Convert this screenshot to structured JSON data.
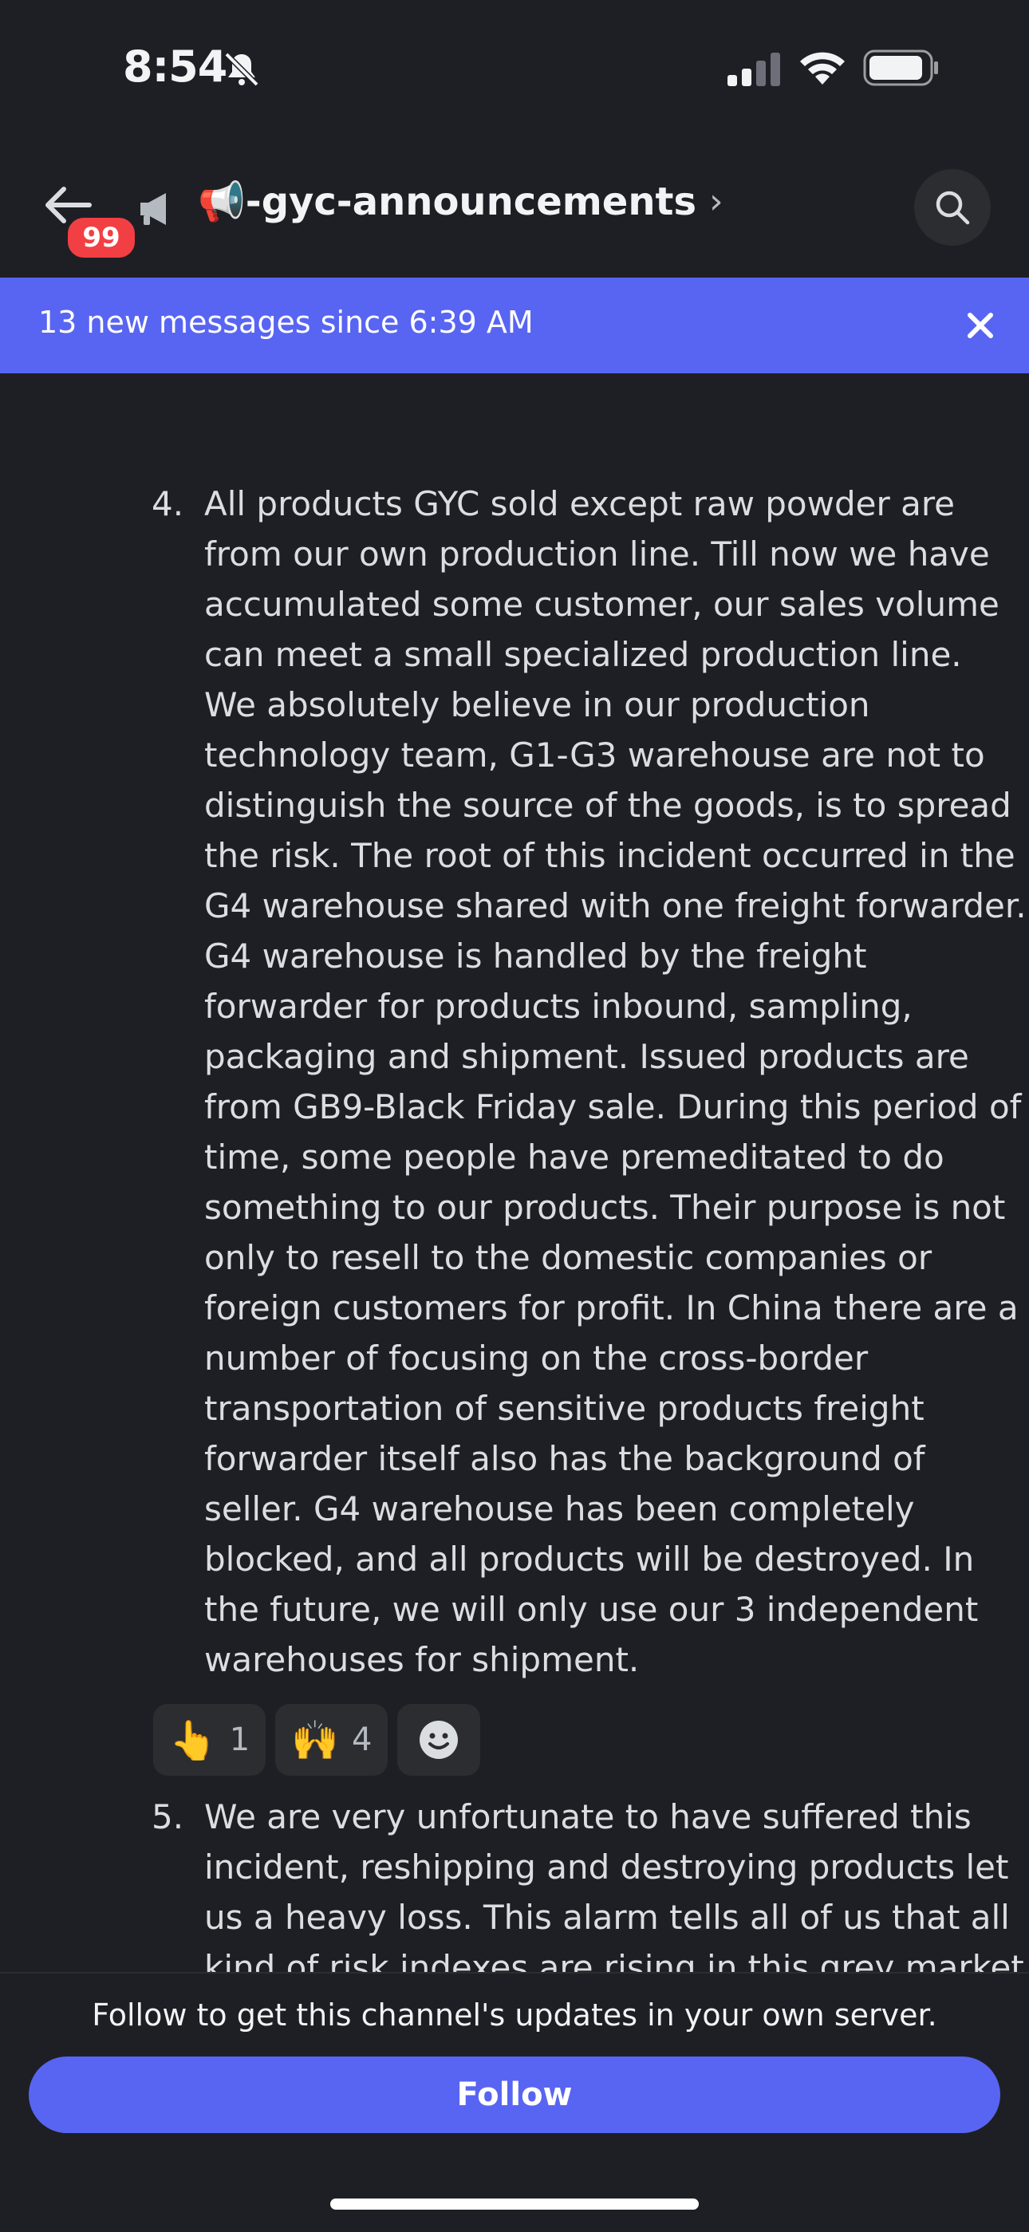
{
  "status_bar": {
    "time": "8:54"
  },
  "header": {
    "unread_badge": "99",
    "channel_emoji": "📢",
    "channel_name": "-gyc-announcements",
    "chevron": "›"
  },
  "new_messages_bar": {
    "text": "13 new messages since 6:39 AM",
    "close_icon": "×"
  },
  "message": {
    "item4": {
      "number": "4.",
      "lines": [
        "All products GYC sold except raw powder are",
        "from our own production line. Till now we have",
        "accumulated some customer, our sales volume",
        "can meet a small specialized production line.",
        "We absolutely believe in our production",
        "technology team, G1-G3 warehouse are not to",
        "distinguish the source of the goods, is to spread",
        "the risk. The root of this incident occurred in the",
        "G4 warehouse shared with one freight forwarder.",
        "G4 warehouse is handled by the freight",
        "forwarder for products inbound, sampling,",
        "packaging and shipment. Issued products are",
        "from GB9-Black Friday sale. During this period of",
        "time, some people have premeditated to do",
        "something to our products. Their purpose is not",
        "only to resell to the domestic companies or",
        "foreign customers for profit. In China there are a",
        "number of focusing on the cross-border",
        "transportation of sensitive products freight",
        "forwarder itself also has the background of",
        "seller. G4 warehouse has been completely",
        "blocked, and all products will be destroyed. In",
        "the future, we will only use our 3 independent",
        "warehouses for shipment."
      ]
    },
    "reactions": [
      {
        "emoji": "👆",
        "count": "1"
      },
      {
        "emoji": "🙌",
        "count": "4"
      }
    ],
    "item5": {
      "number": "5.",
      "lines": [
        "We are very unfortunate to have suffered this",
        "incident, reshipping and destroying products let",
        "us a heavy loss. This alarm tells all of us that all",
        "kind of risk indexes are rising in this grey market"
      ]
    }
  },
  "footer": {
    "follow_prompt": "Follow to get this channel's updates in your own server.",
    "follow_label": "Follow"
  },
  "colors": {
    "accent": "#5865f2",
    "badge": "#f23f43",
    "background": "#1e1f24"
  }
}
